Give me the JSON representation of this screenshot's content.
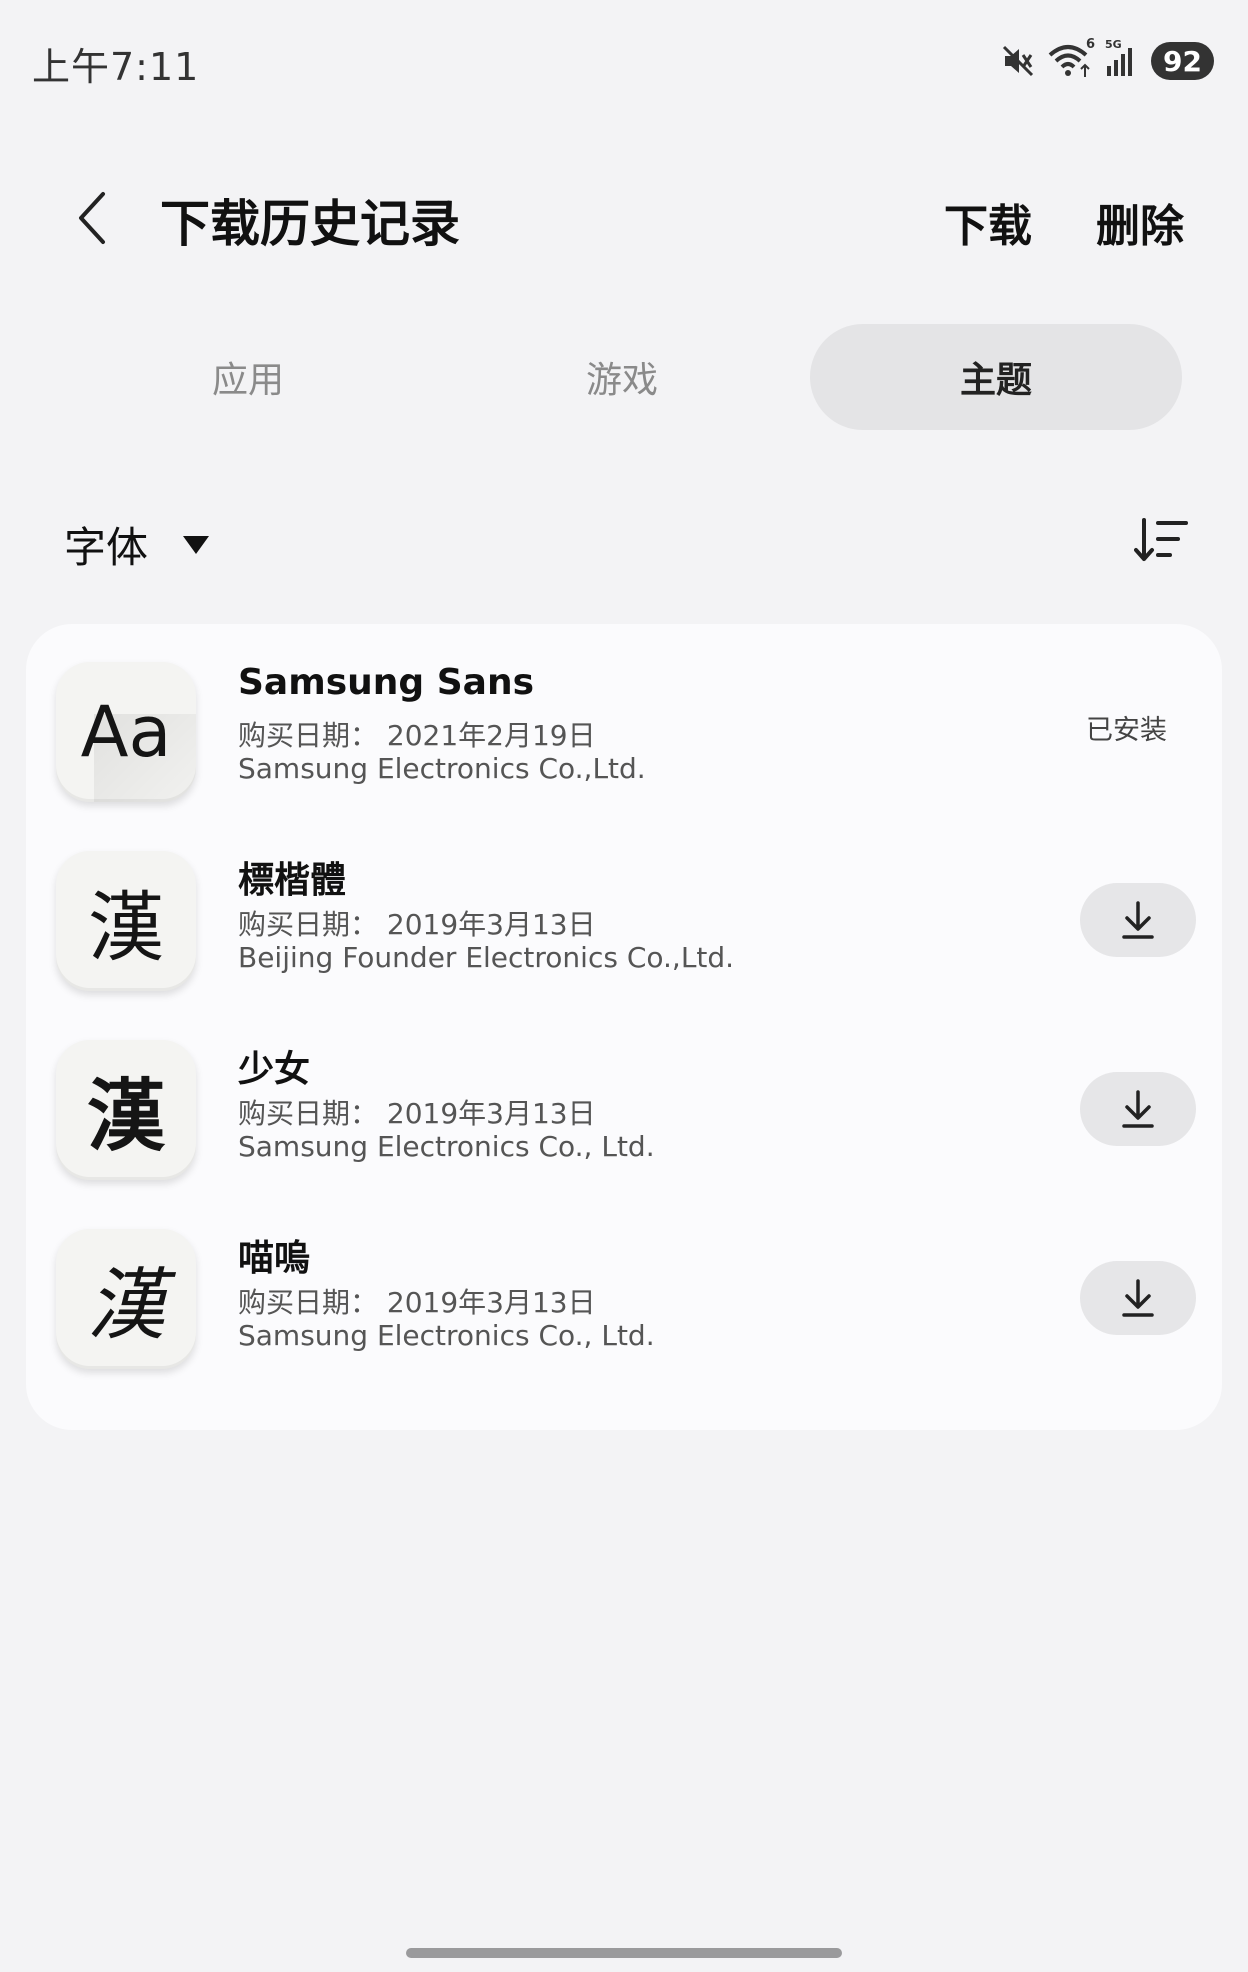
{
  "status_bar": {
    "time": "上午7:11",
    "wifi_badge": "6",
    "signal_badge": "5G",
    "battery": "92"
  },
  "header": {
    "title": "下载历史记录",
    "download_label": "下载",
    "delete_label": "删除"
  },
  "tabs": [
    {
      "label": "应用",
      "active": false
    },
    {
      "label": "游戏",
      "active": false
    },
    {
      "label": "主题",
      "active": true
    }
  ],
  "filter": {
    "selected": "字体"
  },
  "items": [
    {
      "preview": "Aa",
      "name": "Samsung Sans",
      "date": "购买日期： 2021年2月19日",
      "vendor": "Samsung Electronics Co.,Ltd.",
      "status": "已安装"
    },
    {
      "preview": "漢",
      "name": "標楷體",
      "date": "购买日期： 2019年3月13日",
      "vendor": "Beijing Founder Electronics Co.,Ltd.",
      "status": ""
    },
    {
      "preview": "漢",
      "name": "少女",
      "date": "购买日期： 2019年3月13日",
      "vendor": "Samsung Electronics Co., Ltd.",
      "status": ""
    },
    {
      "preview": "漢",
      "name": "喵嗚",
      "date": "购买日期： 2019年3月13日",
      "vendor": "Samsung Electronics Co., Ltd.",
      "status": ""
    }
  ]
}
